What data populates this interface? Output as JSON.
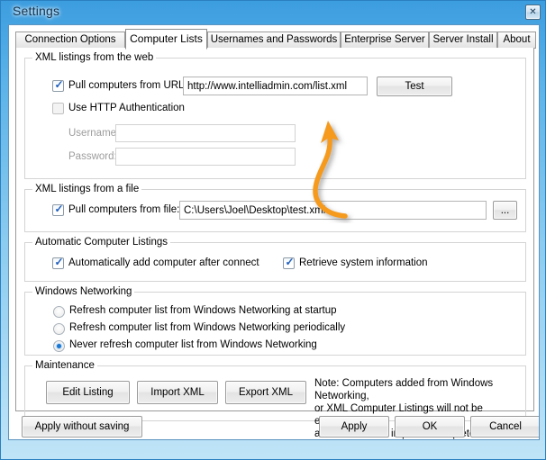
{
  "window": {
    "title": "Settings",
    "close_icon": "close-icon",
    "accent_color": "#5cb3e8",
    "highlight_color": "#f59a1e"
  },
  "tabs": [
    {
      "label": "Connection Options",
      "active": false
    },
    {
      "label": "Computer Lists",
      "active": true
    },
    {
      "label": "Usernames and Passwords",
      "active": false
    },
    {
      "label": "Enterprise Server",
      "active": false
    },
    {
      "label": "Server Install",
      "active": false
    },
    {
      "label": "About",
      "active": false
    }
  ],
  "web_group": {
    "title": "XML listings from the web",
    "pull_url_label": "Pull computers from URL:",
    "pull_url_checked": true,
    "url_value": "http://www.intelliadmin.com/list.xml",
    "test_button": "Test",
    "http_auth_label": "Use HTTP Authentication",
    "http_auth_checked": false,
    "username_label": "Username:",
    "username_value": "",
    "password_label": "Password:",
    "password_value": ""
  },
  "file_group": {
    "title": "XML listings from a file",
    "pull_file_label": "Pull computers from file:",
    "pull_file_checked": true,
    "file_value": "C:\\Users\\Joel\\Desktop\\test.xml",
    "browse_button": "..."
  },
  "auto_group": {
    "title": "Automatic Computer Listings",
    "auto_add_label": "Automatically add computer after connect",
    "auto_add_checked": true,
    "retrieve_label": "Retrieve system information",
    "retrieve_checked": true
  },
  "networking_group": {
    "title": "Windows Networking",
    "options": [
      {
        "label": "Refresh computer list from Windows Networking at startup",
        "selected": false
      },
      {
        "label": "Refresh computer list from Windows Networking periodically",
        "selected": false
      },
      {
        "label": "Never refresh computer list from Windows Networking",
        "selected": true
      }
    ]
  },
  "maintenance_group": {
    "title": "Maintenance",
    "edit_button": "Edit Listing",
    "import_button": "Import XML",
    "export_button": "Export XML",
    "note": "Note: Computers added from Windows Networking,\nor XML Computer Listings will not be exported, or\naltered when an import is completed."
  },
  "footer": {
    "apply_without_saving": "Apply without saving",
    "apply": "Apply",
    "ok": "OK",
    "cancel": "Cancel"
  },
  "annotation": {
    "arrow_icon": "curved-arrow-icon",
    "color": "#f59a1e"
  }
}
